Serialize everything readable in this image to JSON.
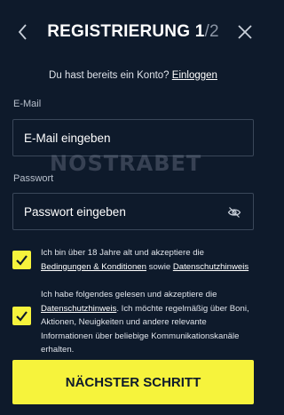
{
  "header": {
    "title": "REGISTRIERUNG 1",
    "step_total": "/2",
    "back_icon": "chevron-left-icon",
    "close_icon": "close-icon"
  },
  "login_prompt": {
    "text": "Du hast bereits ein Konto?",
    "link": "Einloggen"
  },
  "email": {
    "label": "E-Mail",
    "placeholder": "E-Mail eingeben"
  },
  "password": {
    "label": "Passwort",
    "placeholder": "Passwort eingeben",
    "toggle_icon": "eye-slash-icon"
  },
  "watermark": "NOSTRABET",
  "consent_age": {
    "checked": true,
    "text_1": "Ich bin über 18 Jahre alt und akzeptiere die",
    "link_terms": "Bedingungen & Konditionen",
    "text_2": "sowie",
    "link_privacy": "Datenschutzhinweis"
  },
  "consent_marketing": {
    "checked": true,
    "text_1": "Ich habe folgendes gelesen und akzeptiere die",
    "link_privacy": "Datenschutzhinweis",
    "text_2": ". Ich möchte regelmäßig über Boni, Aktionen, Neuigkeiten und andere relevante Informationen über beliebige Kommunikationskanäle erhalten."
  },
  "next_button": "NÄCHSTER SCHRITT",
  "colors": {
    "background": "#0e1a2b",
    "accent": "#f6f33c",
    "input_border": "#3a4759"
  }
}
